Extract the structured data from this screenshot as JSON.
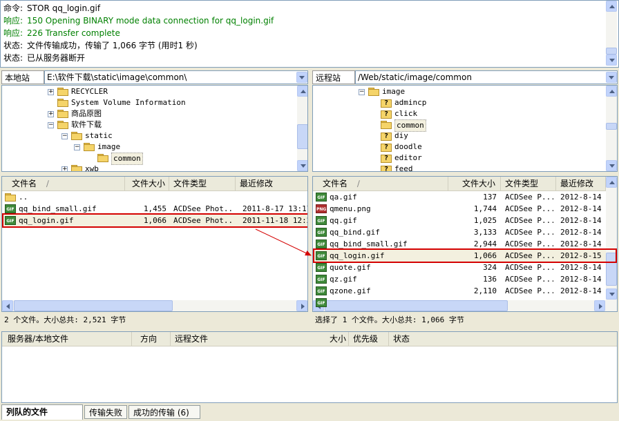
{
  "log": [
    {
      "label": "命令:",
      "text": "STOR qq_login.gif",
      "color": "#000000"
    },
    {
      "label": "响应:",
      "text": "150 Opening BINARY mode data connection for qq_login.gif",
      "color": "#008000"
    },
    {
      "label": "响应:",
      "text": "226 Transfer complete",
      "color": "#008000"
    },
    {
      "label": "状态:",
      "text": "文件传输成功，传输了 1,066 字节 (用时1 秒)",
      "color": "#000000"
    },
    {
      "label": "状态:",
      "text": "已从服务器断开",
      "color": "#000000"
    }
  ],
  "local": {
    "site_label": "本地站点:",
    "path": "E:\\软件下载\\static\\image\\common\\",
    "tree": [
      {
        "label": "RECYCLER",
        "toggle": "+",
        "icon": "folder"
      },
      {
        "label": "System Volume Information",
        "toggle": "",
        "icon": "folder"
      },
      {
        "label": "商品原图",
        "toggle": "+",
        "icon": "folder"
      },
      {
        "label": "软件下载",
        "toggle": "-",
        "icon": "folder"
      },
      {
        "label": "static",
        "toggle": "-",
        "icon": "folder"
      },
      {
        "label": "image",
        "toggle": "-",
        "icon": "folder"
      },
      {
        "label": "common",
        "toggle": "",
        "icon": "folder",
        "selected": true
      },
      {
        "label": "xwb",
        "toggle": "+",
        "icon": "folder"
      }
    ],
    "columns": [
      "文件名",
      "文件大小",
      "文件类型",
      "最近修改"
    ],
    "sort_glyph": "∕",
    "rows": [
      {
        "name": "..",
        "size": "",
        "type": "",
        "modified": "",
        "icon": "folder"
      },
      {
        "name": "qq_bind_small.gif",
        "size": "1,455",
        "type": "ACDSee Phot...",
        "modified": "2011-8-17 13:17:",
        "icon": "gif"
      },
      {
        "name": "qq_login.gif",
        "size": "1,066",
        "type": "ACDSee Phot...",
        "modified": "2011-11-18 12:2.",
        "icon": "gif",
        "highlight": true
      }
    ],
    "status": "2 个文件。大小总共: 2,521 字节"
  },
  "remote": {
    "site_label": "远程站点:",
    "path": "/Web/static/image/common",
    "tree": [
      {
        "label": "image",
        "toggle": "-",
        "icon": "folder"
      },
      {
        "label": "admincp",
        "toggle": "",
        "icon": "qfolder"
      },
      {
        "label": "click",
        "toggle": "",
        "icon": "qfolder"
      },
      {
        "label": "common",
        "toggle": "",
        "icon": "folder",
        "selected": true
      },
      {
        "label": "diy",
        "toggle": "",
        "icon": "qfolder"
      },
      {
        "label": "doodle",
        "toggle": "",
        "icon": "qfolder"
      },
      {
        "label": "editor",
        "toggle": "",
        "icon": "qfolder"
      },
      {
        "label": "feed",
        "toggle": "",
        "icon": "qfolder"
      }
    ],
    "columns": [
      "文件名",
      "文件大小",
      "文件类型",
      "最近修改"
    ],
    "sort_glyph": "∕",
    "rows": [
      {
        "name": "qa.gif",
        "size": "137",
        "type": "ACDSee P...",
        "modified": "2012-8-14 1",
        "icon": "gif"
      },
      {
        "name": "qmenu.png",
        "size": "1,744",
        "type": "ACDSee P...",
        "modified": "2012-8-14 1",
        "icon": "png"
      },
      {
        "name": "qq.gif",
        "size": "1,025",
        "type": "ACDSee P...",
        "modified": "2012-8-14 1",
        "icon": "gif"
      },
      {
        "name": "qq_bind.gif",
        "size": "3,133",
        "type": "ACDSee P...",
        "modified": "2012-8-14 1",
        "icon": "gif"
      },
      {
        "name": "qq_bind_small.gif",
        "size": "2,944",
        "type": "ACDSee P...",
        "modified": "2012-8-14 1",
        "icon": "gif"
      },
      {
        "name": "qq_login.gif",
        "size": "1,066",
        "type": "ACDSee P...",
        "modified": "2012-8-15 1",
        "icon": "gif",
        "highlight": true
      },
      {
        "name": "quote.gif",
        "size": "324",
        "type": "ACDSee P...",
        "modified": "2012-8-14 1",
        "icon": "gif"
      },
      {
        "name": "qz.gif",
        "size": "136",
        "type": "ACDSee P...",
        "modified": "2012-8-14 1",
        "icon": "gif"
      },
      {
        "name": "qzone.gif",
        "size": "2,110",
        "type": "ACDSee P...",
        "modified": "2012-8-14 1",
        "icon": "gif"
      },
      {
        "name": "",
        "size": "",
        "type": "",
        "modified": "",
        "icon": "gif",
        "partial": true
      }
    ],
    "status": "选择了 1 个文件。大小总共: 1,066 字节"
  },
  "queue": {
    "columns": [
      "服务器/本地文件",
      "方向",
      "远程文件",
      "大小",
      "优先级",
      "状态"
    ]
  },
  "tabs": [
    {
      "label": "列队的文件",
      "active": true
    },
    {
      "label": "传输失败",
      "active": false
    },
    {
      "label": "成功的传输 (6)",
      "active": false
    }
  ],
  "colors": {
    "highlight": "#d40000",
    "selection": "#f3f0df",
    "panel_bg": "#ece9d8"
  }
}
